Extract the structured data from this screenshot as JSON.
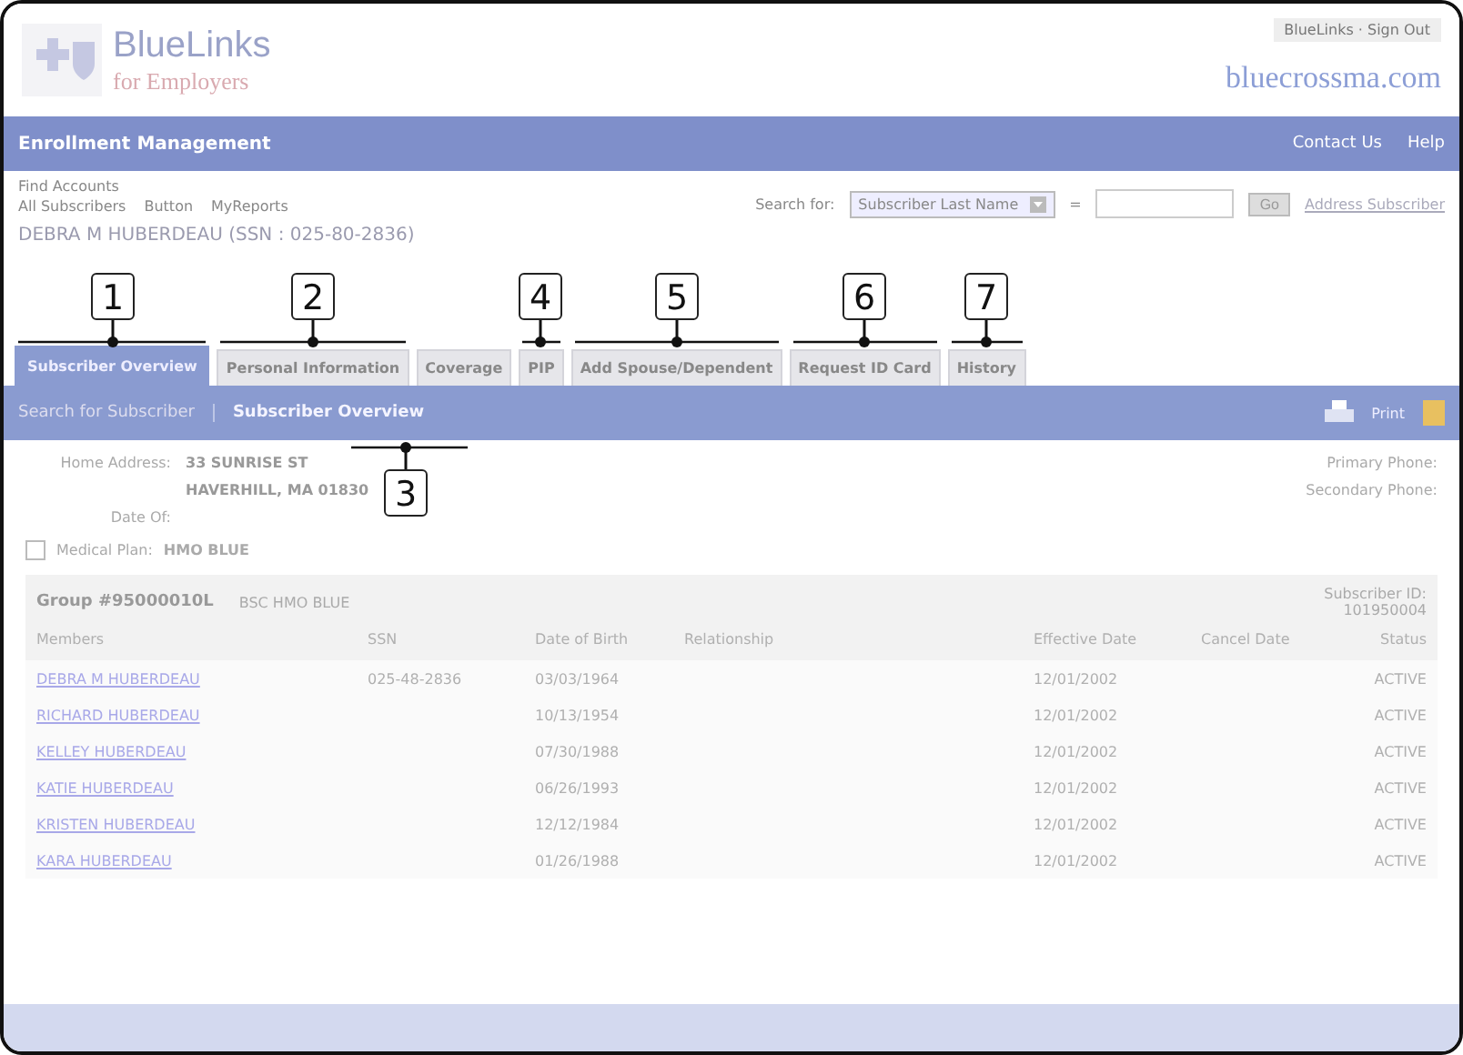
{
  "header": {
    "logo_title": "BlueLinks",
    "logo_subtitle": "for Employers",
    "account_links": "BlueLinks · Sign Out",
    "site": "bluecrossma.com"
  },
  "nav_bar": {
    "title": "Enrollment Management",
    "links": [
      "Contact Us",
      "Help"
    ]
  },
  "find_accounts": {
    "label": "Find Accounts",
    "links": [
      "All Subscribers",
      "Button",
      "MyReports"
    ]
  },
  "search": {
    "label": "Search for:",
    "field": "Subscriber Last Name",
    "operator": "=",
    "button": "Go",
    "link": "Address Subscriber"
  },
  "subscriber_heading": "DEBRA M HUBERDEAU (SSN : 025-80-2836)",
  "tabs": [
    {
      "label": "Subscriber Overview",
      "selected": true
    },
    {
      "label": "Personal Information",
      "selected": false
    },
    {
      "label": "Coverage",
      "selected": false
    },
    {
      "label": "PIP",
      "selected": false
    },
    {
      "label": "Add Spouse/Dependent",
      "selected": false
    },
    {
      "label": "Request ID Card",
      "selected": false
    },
    {
      "label": "History",
      "selected": false
    }
  ],
  "sub_bar": {
    "links": [
      "Search for Subscriber",
      "Subscriber Overview"
    ],
    "print": "Print"
  },
  "details": {
    "home_address_label": "Home Address:",
    "address_lines": [
      "33 SUNRISE ST",
      "HAVERHILL, MA 01830"
    ],
    "date_label": "Date Of:",
    "phone_labels": [
      "Primary Phone:",
      "Secondary Phone:"
    ],
    "plan_label": "Medical Plan:",
    "plan": "HMO BLUE"
  },
  "group": {
    "number": "Group #95000010L",
    "plan": "BSC HMO BLUE",
    "subscriber_id": "Subscriber ID: 101950004"
  },
  "table": {
    "columns": [
      "Members",
      "SSN",
      "Date of Birth",
      "Relationship",
      "Effective Date",
      "Cancel Date",
      "Status"
    ],
    "rows": [
      {
        "member": "DEBRA M HUBERDEAU",
        "ssn": "025-48-2836",
        "dob": "03/03/1964",
        "effective": "12/01/2002",
        "status": "ACTIVE"
      },
      {
        "member": "RICHARD HUBERDEAU",
        "dob": "10/13/1954",
        "effective": "12/01/2002",
        "status": "ACTIVE"
      },
      {
        "member": "KELLEY HUBERDEAU",
        "dob": "07/30/1988",
        "effective": "12/01/2002",
        "status": "ACTIVE"
      },
      {
        "member": "KATIE HUBERDEAU",
        "dob": "06/26/1993",
        "effective": "12/01/2002",
        "status": "ACTIVE"
      },
      {
        "member": "KRISTEN HUBERDEAU",
        "dob": "12/12/1984",
        "effective": "12/01/2002",
        "status": "ACTIVE"
      },
      {
        "member": "KARA HUBERDEAU",
        "dob": "01/26/1988",
        "effective": "12/01/2002",
        "status": "ACTIVE"
      }
    ]
  },
  "callouts": [
    {
      "number": "1"
    },
    {
      "number": "2"
    },
    {
      "number": "3"
    },
    {
      "number": "4"
    },
    {
      "number": "5"
    },
    {
      "number": "6"
    },
    {
      "number": "7"
    }
  ]
}
